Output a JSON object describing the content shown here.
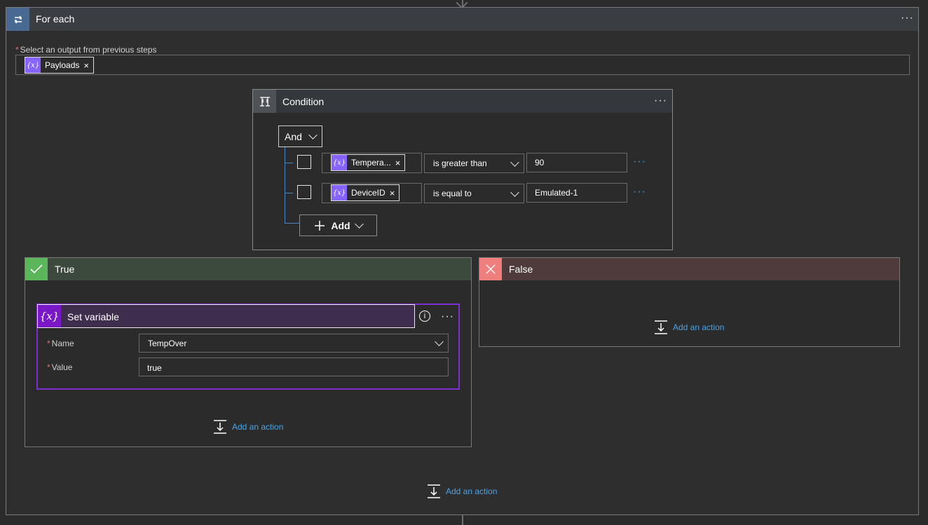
{
  "foreach": {
    "title": "For each",
    "select_label": "Select an output from previous steps",
    "token": "Payloads"
  },
  "condition": {
    "title": "Condition",
    "group_operator": "And",
    "rows": [
      {
        "token": "Tempera...",
        "operator": "is greater than",
        "value": "90"
      },
      {
        "token": "DeviceID",
        "operator": "is equal to",
        "value": "Emulated-1"
      }
    ],
    "add_label": "Add"
  },
  "true_branch": {
    "title": "True",
    "set_variable": {
      "title": "Set variable",
      "name_label": "Name",
      "name_value": "TempOver",
      "value_label": "Value",
      "value_value": "true"
    },
    "add_action": "Add an action"
  },
  "false_branch": {
    "title": "False",
    "add_action": "Add an action"
  },
  "foreach_add_action": "Add an action",
  "icons": {
    "foreach": "loop-icon",
    "condition": "condition-icon",
    "token": "expression-icon",
    "true": "check-icon",
    "false": "close-icon",
    "set_variable": "variable-icon",
    "info": "info-icon",
    "add_action": "add-action-icon"
  },
  "colors": {
    "accent_link": "#4aa3e6",
    "token": "#8764ff",
    "variable": "#7a17c7",
    "true": "#5bb65b",
    "false": "#ee7f7c",
    "foreach": "#486991"
  }
}
